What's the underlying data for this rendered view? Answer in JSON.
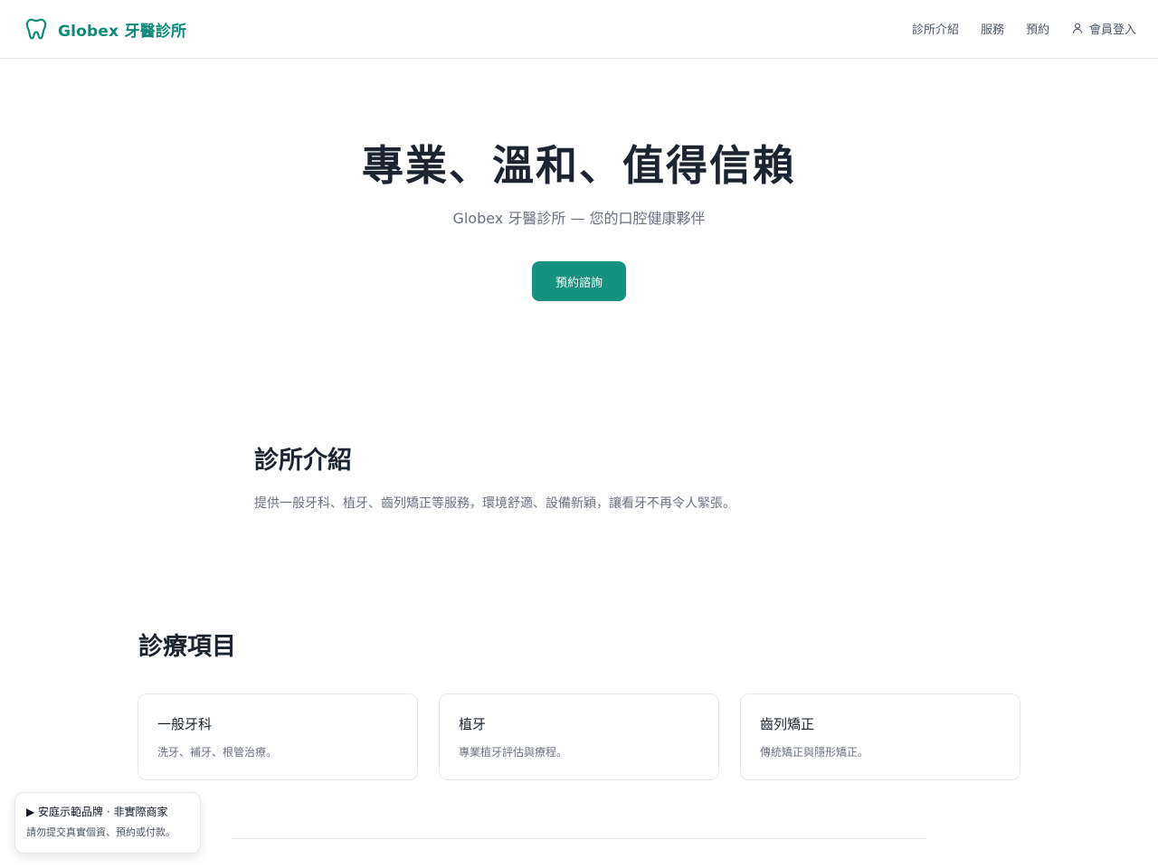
{
  "header": {
    "brand_name": "Globex 牙醫診所",
    "nav": {
      "about": "診所介紹",
      "services": "服務",
      "booking": "預約",
      "login": "會員登入"
    }
  },
  "hero": {
    "title": "專業、溫和、值得信賴",
    "subtitle": "Globex 牙醫診所 — 您的口腔健康夥伴",
    "cta_label": "預約諮詢"
  },
  "about": {
    "title": "診所介紹",
    "text": "提供一般牙科、植牙、齒列矯正等服務，環境舒適、設備新穎，讓看牙不再令人緊張。"
  },
  "services": {
    "title": "診療項目",
    "items": [
      {
        "title": "一般牙科",
        "desc": "洗牙、補牙、根管治療。"
      },
      {
        "title": "植牙",
        "desc": "專業植牙評估與療程。"
      },
      {
        "title": "齒列矯正",
        "desc": "傳統矯正與隱形矯正。"
      }
    ]
  },
  "notice": {
    "title": "▶ 安庭示範品牌 · 非實際商家",
    "text": "請勿提交真實個資、預約或付款。"
  },
  "colors": {
    "brand": "#0f8a7a",
    "accent": "#15917f",
    "heading": "#1b2430",
    "muted": "#6b7280",
    "border": "#e5e7eb"
  },
  "icons": {
    "logo": "tooth-icon",
    "login": "user-icon"
  }
}
